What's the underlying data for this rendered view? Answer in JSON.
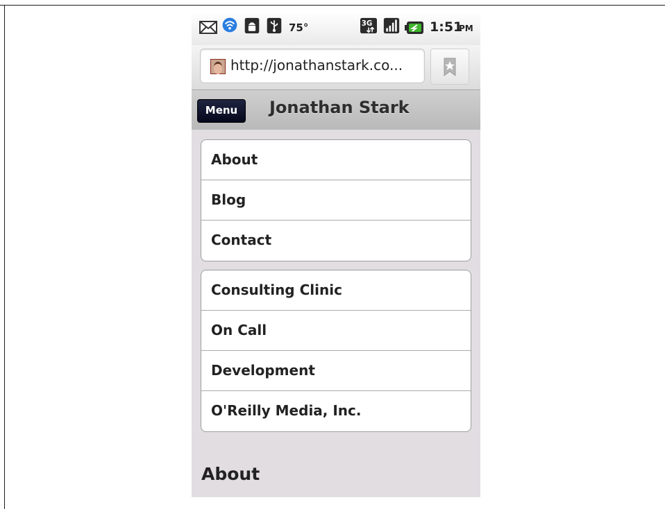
{
  "status_bar": {
    "temperature": "75°",
    "network": "3G",
    "time": "1:51",
    "ampm": "PM",
    "icons": [
      "mail-icon",
      "wifi-icon",
      "android-debug-icon",
      "usb-icon",
      "network-3g-icon",
      "signal-icon",
      "battery-charging-icon"
    ]
  },
  "browser": {
    "url": "http://jonathanstark.co...",
    "bookmark_icon": "bookmark-icon"
  },
  "header": {
    "menu_label": "Menu",
    "title": "Jonathan Stark"
  },
  "nav_lists": [
    {
      "items": [
        "About",
        "Blog",
        "Contact"
      ]
    },
    {
      "items": [
        "Consulting Clinic",
        "On Call",
        "Development",
        "O'Reilly Media, Inc."
      ]
    }
  ],
  "section": {
    "heading": "About"
  },
  "colors": {
    "screen_bg": "#e1dde1",
    "menu_button": "#0b0e24",
    "battery_green": "#3fb62c"
  }
}
